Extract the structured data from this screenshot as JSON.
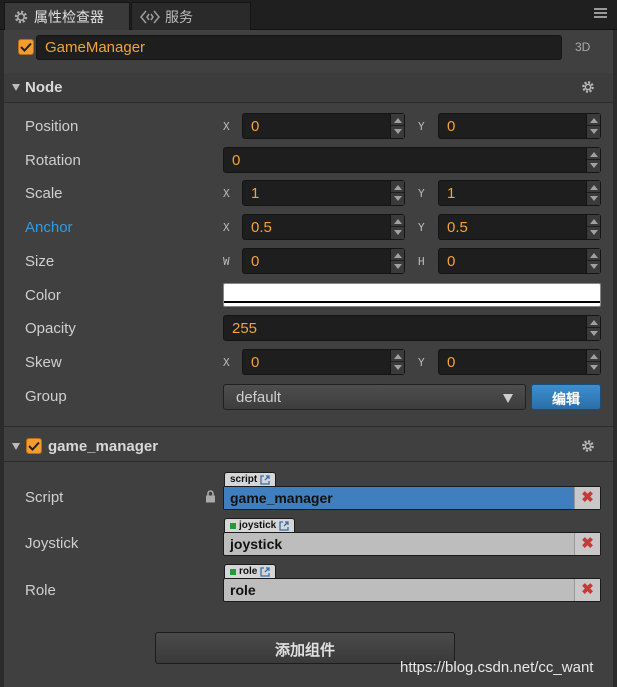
{
  "tabs": [
    {
      "label": "属性检查器",
      "icon": "gear-icon",
      "active": true
    },
    {
      "label": "服务",
      "icon": "service-icon",
      "active": false
    }
  ],
  "node_header": {
    "enabled": true,
    "name": "GameManager",
    "mode_label": "3D"
  },
  "node_section": {
    "title": "Node"
  },
  "properties": {
    "position": {
      "label": "Position",
      "x_axis": "X",
      "x": "0",
      "y_axis": "Y",
      "y": "0"
    },
    "rotation": {
      "label": "Rotation",
      "value": "0"
    },
    "scale": {
      "label": "Scale",
      "x_axis": "X",
      "x": "1",
      "y_axis": "Y",
      "y": "1"
    },
    "anchor": {
      "label": "Anchor",
      "x_axis": "X",
      "x": "0.5",
      "y_axis": "Y",
      "y": "0.5"
    },
    "size": {
      "label": "Size",
      "w_axis": "W",
      "w": "0",
      "h_axis": "H",
      "h": "0"
    },
    "color": {
      "label": "Color",
      "value": "#ffffff"
    },
    "opacity": {
      "label": "Opacity",
      "value": "255"
    },
    "skew": {
      "label": "Skew",
      "x_axis": "X",
      "x": "0",
      "y_axis": "Y",
      "y": "0"
    },
    "group": {
      "label": "Group",
      "value": "default",
      "edit_label": "编辑"
    }
  },
  "component": {
    "enabled": true,
    "title": "game_manager",
    "script": {
      "label": "Script",
      "tag": "script",
      "value": "game_manager"
    },
    "joystick": {
      "label": "Joystick",
      "tag": "joystick",
      "value": "joystick"
    },
    "role": {
      "label": "Role",
      "tag": "role",
      "value": "role"
    }
  },
  "add_component_label": "添加组件",
  "watermark": "https://blog.csdn.net/cc_want",
  "colors": {
    "accent": "#f49c2c",
    "highlight": "#2f9be6",
    "edit_button": "#3d8fd0",
    "remove": "#c83a3a"
  }
}
